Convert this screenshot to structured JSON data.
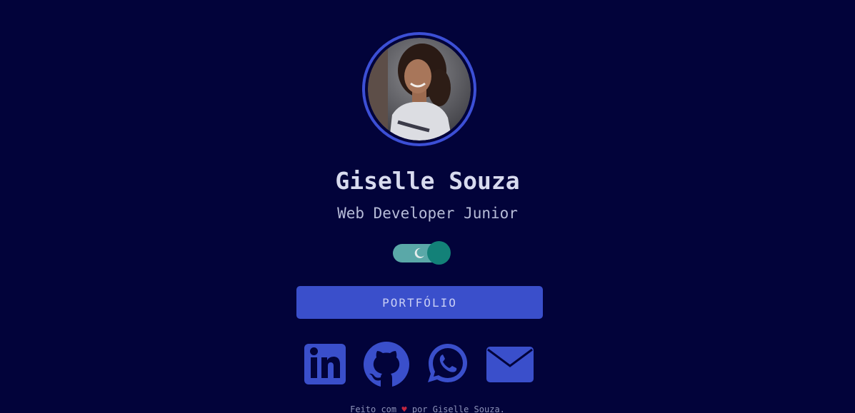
{
  "profile": {
    "name": "Giselle Souza",
    "role": "Web Developer Junior",
    "avatar_icon": "profile-photo"
  },
  "theme_toggle": {
    "state": "dark",
    "icon": "moon-icon"
  },
  "portfolio_button": {
    "label": "PORTFÓLIO"
  },
  "social_links": [
    {
      "name": "LinkedIn",
      "icon": "linkedin-icon"
    },
    {
      "name": "GitHub",
      "icon": "github-icon"
    },
    {
      "name": "WhatsApp",
      "icon": "whatsapp-icon"
    },
    {
      "name": "E-mail",
      "icon": "mail-icon"
    }
  ],
  "footer": {
    "prefix": "Feito com",
    "heart": "♥",
    "suffix": "por Giselle Souza."
  },
  "colors": {
    "background": "#02033a",
    "accent": "#3a4fcb",
    "toggle_track": "#5aa8a8",
    "toggle_knob": "#138178"
  }
}
